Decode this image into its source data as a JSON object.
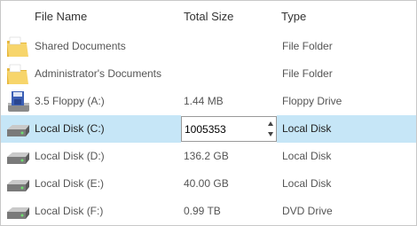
{
  "columns": {
    "name": "File Name",
    "size": "Total Size",
    "type": "Type"
  },
  "rows": [
    {
      "icon": "folder-icon",
      "name": "Shared Documents",
      "size": "",
      "type": "File Folder"
    },
    {
      "icon": "folder-icon",
      "name": "Administrator's Documents",
      "size": "",
      "type": "File Folder"
    },
    {
      "icon": "floppy-drive-icon",
      "name": "3.5 Floppy (A:)",
      "size": "1.44 MB",
      "type": "Floppy Drive"
    },
    {
      "icon": "hard-disk-icon",
      "name": "Local Disk (C:)",
      "size": "",
      "type": "Local Disk",
      "selected": true
    },
    {
      "icon": "hard-disk-icon",
      "name": "Local Disk (D:)",
      "size": "136.2 GB",
      "type": "Local Disk"
    },
    {
      "icon": "hard-disk-icon",
      "name": "Local Disk (E:)",
      "size": "40.00 GB",
      "type": "Local Disk"
    },
    {
      "icon": "hard-disk-icon",
      "name": "Local Disk (F:)",
      "size": "0.99 TB",
      "type": "DVD Drive"
    }
  ],
  "editor": {
    "value": "1005353",
    "spin_up_icon": "spin-up-icon",
    "spin_down_icon": "spin-down-icon"
  },
  "colors": {
    "selection": "#c6e6f7",
    "folder": "#f2c94c",
    "disk": "#6b6b6b"
  }
}
